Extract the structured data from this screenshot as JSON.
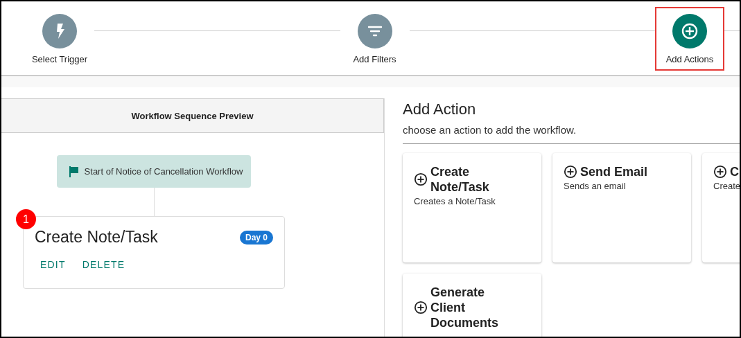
{
  "steps": [
    {
      "label": "Select Trigger",
      "selected": false,
      "highlighted": false
    },
    {
      "label": "Add Filters",
      "selected": false,
      "highlighted": false
    },
    {
      "label": "Add Actions",
      "selected": true,
      "highlighted": true
    }
  ],
  "preview": {
    "title": "Workflow Sequence Preview",
    "start": "Start of Notice of Cancellation Workflow",
    "items": [
      {
        "number": "1",
        "title": "Create Note/Task",
        "badge": "Day 0",
        "actions": [
          "EDIT",
          "DELETE"
        ]
      }
    ]
  },
  "add_action": {
    "title": "Add Action",
    "subtitle": "choose an action to add the workflow.",
    "cards": [
      {
        "title": "Create Note/Task",
        "description": "Creates a Note/Task"
      },
      {
        "title": "Send Email",
        "description": "Sends an email"
      },
      {
        "title": "C",
        "description": "Create"
      },
      {
        "title": "Generate Client Documents"
      }
    ]
  }
}
